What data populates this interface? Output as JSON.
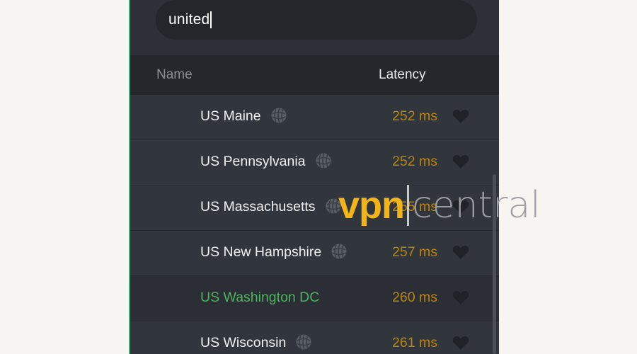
{
  "search": {
    "value": "united"
  },
  "header": {
    "name_label": "Name",
    "latency_label": "Latency"
  },
  "servers": [
    {
      "name": "US Maine",
      "latency": "252 ms",
      "connected": false,
      "has_globe": true
    },
    {
      "name": "US Pennsylvania",
      "latency": "252 ms",
      "connected": false,
      "has_globe": true
    },
    {
      "name": "US Massachusetts",
      "latency": "255 ms",
      "connected": false,
      "has_globe": true
    },
    {
      "name": "US New Hampshire",
      "latency": "257 ms",
      "connected": false,
      "has_globe": true
    },
    {
      "name": "US Washington DC",
      "latency": "260 ms",
      "connected": true,
      "has_globe": false
    },
    {
      "name": "US Wisconsin",
      "latency": "261 ms",
      "connected": false,
      "has_globe": true
    }
  ],
  "icons": {
    "server_type": "globe-icon",
    "favorite": "heart-icon"
  },
  "colors": {
    "connected": "#4cb35f",
    "latency": "#b8860b",
    "accent_border": "#3fa874"
  },
  "watermark": {
    "brand_bold": "vpn",
    "brand_light": "central"
  }
}
